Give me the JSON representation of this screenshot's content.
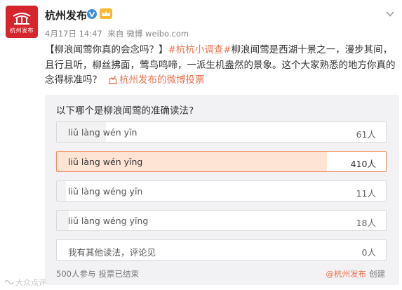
{
  "account": {
    "name": "杭州发布",
    "avatar_label": "杭州发布",
    "avatar_color": "#d6252c"
  },
  "icons": {
    "verified": "verified-v-icon",
    "vip": "vip-crown-icon",
    "menu": "chevron-down-icon",
    "vote": "vote-icon"
  },
  "meta": {
    "date": "4月17日 14:47",
    "source_prefix": "来自",
    "source": "微博 weibo.com"
  },
  "post": {
    "title": "【柳浪闻莺你真的会念吗？】",
    "hashtag": "#杭杭小调查#",
    "body": "柳浪闻莺是西湖十景之一，漫步其间，且行且听，柳丝拂面，莺鸟鸣啼，一派生机盎然的景象。这个大家熟悉的地方你真的念得标准吗？",
    "vote_link": "杭州发布的微博投票"
  },
  "poll": {
    "question": "以下哪个是柳浪闻莺的准确读法?",
    "options": [
      {
        "label": "liǔ làng wén yīn",
        "count": "61人",
        "fraction": 0.149,
        "selected": false
      },
      {
        "label": "liǔ làng wén yīng",
        "count": "410人",
        "fraction": 0.82,
        "selected": true
      },
      {
        "label": "liǔ làng wéng yīn",
        "count": "11人",
        "fraction": 0.027,
        "selected": false
      },
      {
        "label": "liǔ làng wéng yīng",
        "count": "18人",
        "fraction": 0.036,
        "selected": false
      },
      {
        "label": "我有其他读法，评论见",
        "count": "0人",
        "fraction": 0,
        "selected": false
      }
    ],
    "participants": "500人参与",
    "status": "投票已结束",
    "creator": "@杭州发布",
    "created_label": "创建"
  },
  "colors": {
    "accent": "#eb7350",
    "selected_border": "#f08a5d",
    "selected_fill": "#fde4d5"
  },
  "watermark": "大众点评"
}
